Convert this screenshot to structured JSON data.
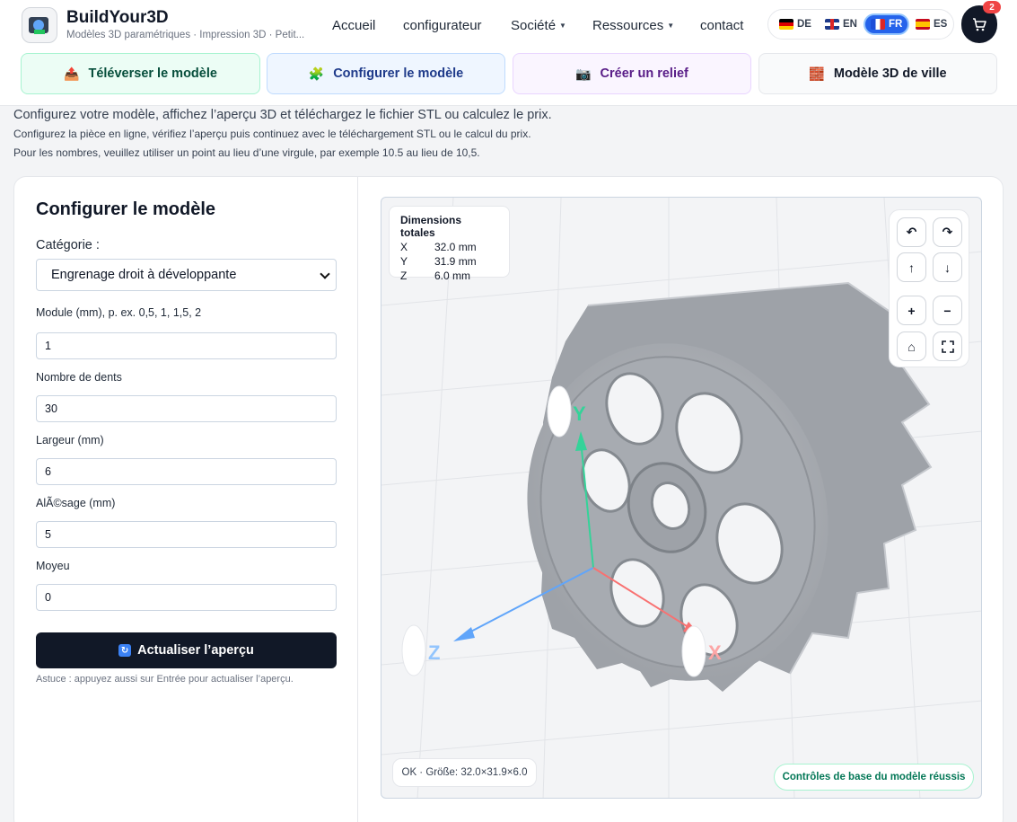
{
  "brand": {
    "name": "BuildYour3D",
    "tagline": "Modèles 3D paramétriques · Impression 3D · Petit..."
  },
  "nav": {
    "home": "Accueil",
    "configurator": "configurateur",
    "company": "Société",
    "resources": "Ressources",
    "contact": "contact"
  },
  "languages": {
    "de": "DE",
    "en": "EN",
    "fr": "FR",
    "es": "ES",
    "active": "FR"
  },
  "cart": {
    "count": "2"
  },
  "tabs": {
    "upload": "Téléverser le modèle",
    "configure": "Configurer le modèle",
    "relief": "Créer un relief",
    "city": "Modèle 3D de ville"
  },
  "intro": {
    "line1": "Configurez votre modèle, affichez l’aperçu 3D et téléchargez le fichier STL ou calculez le prix.",
    "line2": "Configurez la pièce en ligne, vérifiez l’aperçu puis continuez avec le téléchargement STL ou le calcul du prix.",
    "line3": "Pour les nombres, veuillez utiliser un point au lieu d’une virgule, par exemple 10.5 au lieu de 10,5."
  },
  "form": {
    "title": "Configurer le modèle",
    "category_label": "Catégorie :",
    "category_value": "Engrenage droit à développante",
    "module_label": "Module (mm), p. ex. 0,5, 1, 1,5, 2",
    "module_value": "1",
    "teeth_label": "Nombre de dents",
    "teeth_value": "30",
    "width_label": "Largeur (mm)",
    "width_value": "6",
    "bore_label": "AlÃ©sage (mm)",
    "bore_value": "5",
    "hub_label": "Moyeu",
    "hub_value": "0",
    "update_button": "Actualiser l’aperçu",
    "hint": "Astuce : appuyez aussi sur Entrée pour actualiser l’aperçu."
  },
  "viewer": {
    "dims_title": "Dimensions totales",
    "dims": [
      {
        "axis": "X",
        "value": "32.0 mm"
      },
      {
        "axis": "Y",
        "value": "31.9 mm"
      },
      {
        "axis": "Z",
        "value": "6.0 mm"
      }
    ],
    "axis_labels": {
      "x": "X",
      "y": "Y",
      "z": "Z"
    },
    "status_left": "OK · Größe: 32.0×31.9×6.0",
    "status_right": "Contrôles de base du modèle réussis"
  },
  "icons": {
    "logo": "gear-logo-icon",
    "cart": "cart-icon",
    "rotate_left": "rotate-left-icon",
    "rotate_right": "rotate-right-icon",
    "up": "arrow-up-icon",
    "down": "arrow-down-icon",
    "zoom_in": "plus-icon",
    "zoom_out": "minus-icon",
    "home": "home-icon",
    "fullscreen": "fullscreen-icon"
  },
  "colors": {
    "primary_dark": "#111827",
    "active_lang": "#2563eb",
    "success": "#047857",
    "gear": "#a8acb2"
  }
}
